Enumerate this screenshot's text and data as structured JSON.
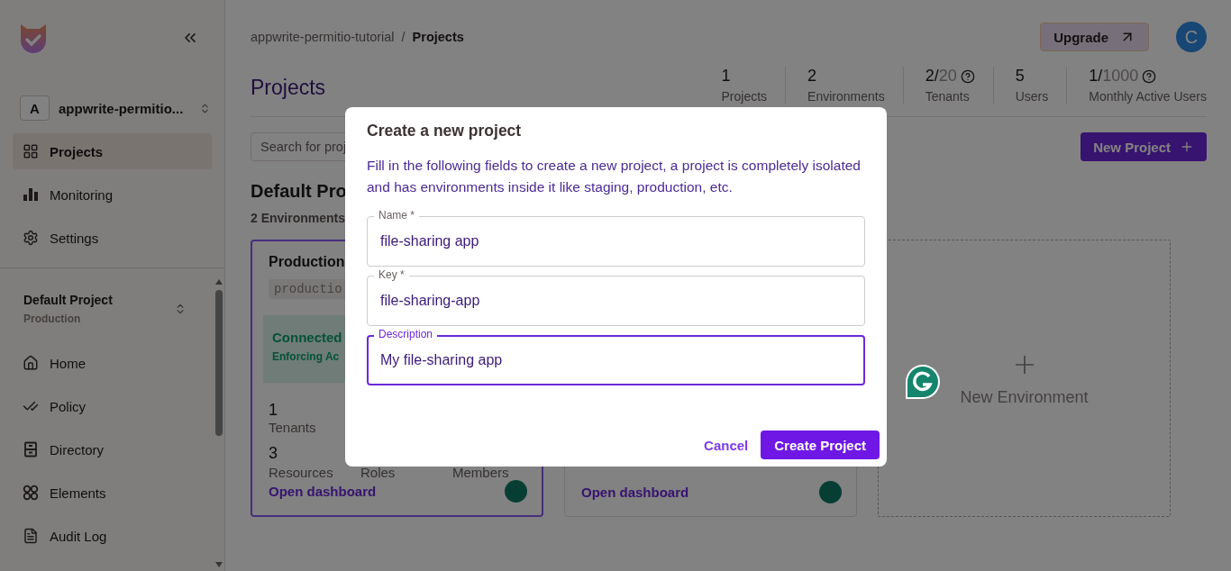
{
  "sidebar": {
    "org": {
      "initial": "A",
      "name": "appwrite-permitio..."
    },
    "top_items": [
      {
        "label": "Projects",
        "selected": true
      },
      {
        "label": "Monitoring",
        "selected": false
      },
      {
        "label": "Settings",
        "selected": false
      }
    ],
    "project": {
      "name": "Default Project",
      "environment": "Production"
    },
    "items": [
      {
        "label": "Home",
        "selected": false
      },
      {
        "label": "Policy",
        "selected": false
      },
      {
        "label": "Directory",
        "selected": false
      },
      {
        "label": "Elements",
        "selected": false
      },
      {
        "label": "Audit Log",
        "selected": false
      }
    ]
  },
  "header": {
    "breadcrumb": [
      "appwrite-permitio-tutorial",
      "Projects"
    ],
    "breadcrumb_separator": "/",
    "upgrade_button": "Upgrade",
    "avatar": "C"
  },
  "page": {
    "title": "Projects",
    "stats": [
      {
        "value": "1",
        "label": "Projects"
      },
      {
        "value": "2",
        "label": "Environments"
      },
      {
        "value": "2/",
        "limit": "20",
        "label": "Tenants"
      },
      {
        "value": "5",
        "label": "Users"
      },
      {
        "value": "1/",
        "limit": "1000",
        "label": "Monthly Active Users"
      }
    ],
    "search": {
      "placeholder": "Search for proj"
    },
    "new_project_button": "New Project",
    "section_title": "Default Pro",
    "section_subtitle": "2 Environments",
    "environments": [
      {
        "kind": "env",
        "selected": true,
        "name": "Production",
        "key": "productio",
        "status": "Connected",
        "status_detail": "Enforcing Ac",
        "stats": [
          {
            "value": "1",
            "label": "Tenants"
          },
          {
            "value": "3",
            "label": "Resources"
          }
        ],
        "stat_labels": [
          "Roles",
          "Members"
        ],
        "link": "Open dashboard"
      },
      {
        "kind": "env",
        "selected": false,
        "link": "Open dashboard"
      },
      {
        "kind": "add",
        "label": "New Environment"
      }
    ]
  },
  "dialog": {
    "title": "Create a new project",
    "description": "Fill in the following fields to create a new project, a project is completely isolated and has environments inside it like staging, production, etc.",
    "fields": [
      {
        "label": "Name *",
        "value": "file-sharing app",
        "focused": false
      },
      {
        "label": "Key *",
        "value": "file-sharing-app",
        "focused": false
      },
      {
        "label": "Description",
        "value": "My file-sharing app",
        "focused": true
      }
    ],
    "cancel_button": "Cancel",
    "submit_button": "Create Project"
  }
}
